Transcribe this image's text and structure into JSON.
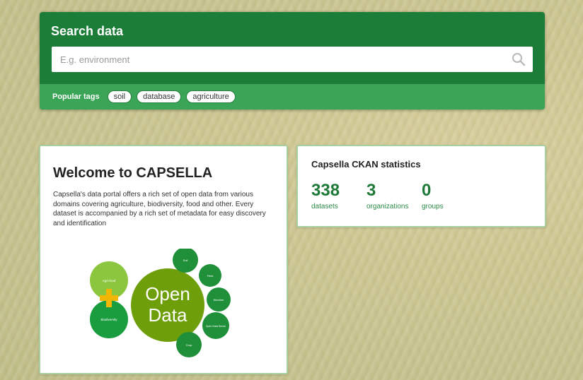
{
  "search": {
    "title": "Search data",
    "placeholder": "E.g. environment",
    "popular_tags_label": "Popular tags",
    "tags": [
      "soil",
      "database",
      "agriculture"
    ]
  },
  "welcome": {
    "title": "Welcome to CAPSELLA",
    "text": "Capsella's data portal offers a rich set of open data from various domains covering agriculture, biodiversity, food and other. Every dataset is accompanied by a rich set of metadata for easy discovery and identification",
    "graphic": {
      "center_line1": "Open",
      "center_line2": "Data",
      "left_top": "Agri-food",
      "left_bottom": "Biodiversity",
      "small_1": "Soil",
      "small_2": "Field",
      "small_3": "Weather",
      "small_4": "Open Data Bench",
      "small_5": "Crop",
      "small_6": "Seeds"
    }
  },
  "stats": {
    "title": "Capsella CKAN statistics",
    "items": [
      {
        "value": "338",
        "label": "datasets"
      },
      {
        "value": "3",
        "label": "organizations"
      },
      {
        "value": "0",
        "label": "groups"
      }
    ]
  },
  "colors": {
    "panel_green": "#1b7d38",
    "tags_bar_green": "#3aa457",
    "stat_green": "#1f7a3a"
  }
}
